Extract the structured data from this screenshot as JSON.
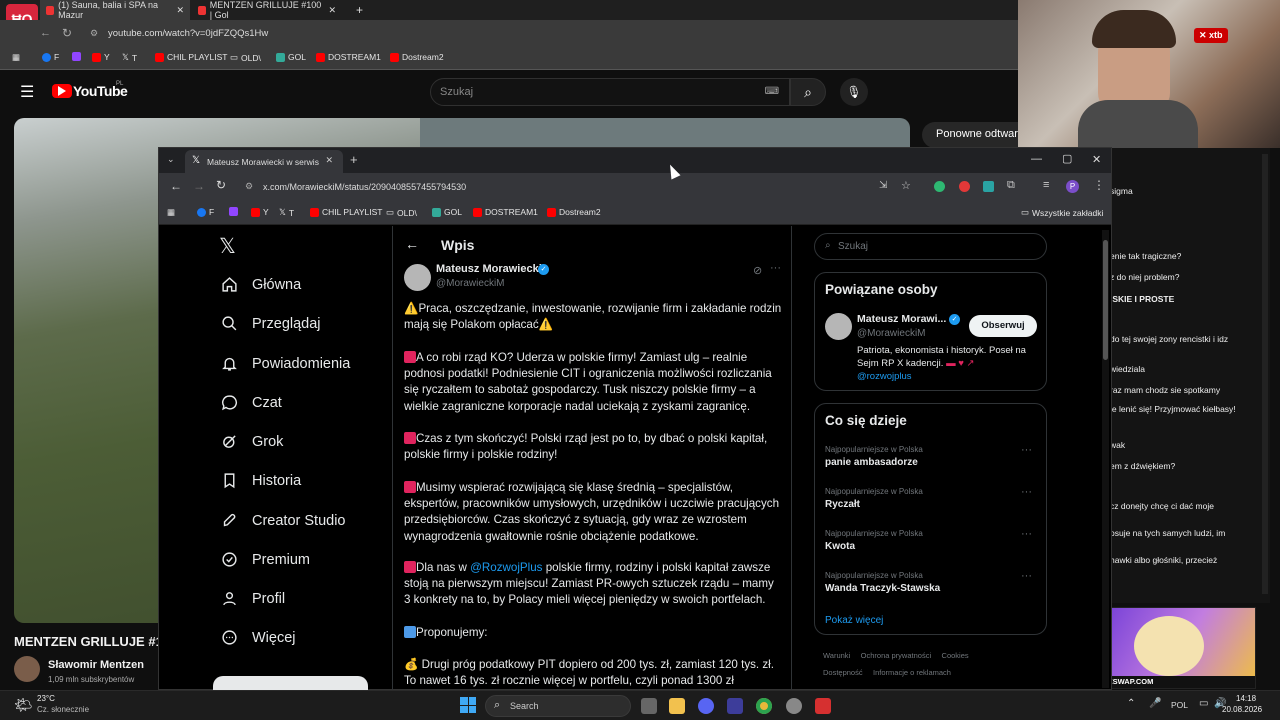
{
  "bg_browser": {
    "tabs": [
      {
        "label": "(1) Sauna, balia i SPA na Mazur"
      },
      {
        "label": "MENTZEN GRILLUJE #100 | Gol"
      }
    ],
    "url": "youtube.com/watch?v=0jdFZQQs1Hw",
    "bookmarks": [
      "F",
      "Y",
      "T",
      "CHIL PLAYLIST",
      "OLD\\",
      "GOL",
      "DOSTREAM1",
      "Dostream2"
    ],
    "youtube_logo": "YouTube",
    "youtube_country": "PL",
    "search_placeholder": "Szukaj",
    "rewatch_button": "Ponowne odtwar",
    "video_title": "MENTZEN GRILLUJE #1",
    "channel_name": "Sławomir Mentzen",
    "channel_subs": "1,09 mln subskrybentów"
  },
  "stream_overlay": {
    "logo": "ĦO",
    "cam_badge": "xtb",
    "banner_text": "PIRATESWAP.COM",
    "chat": [
      "sigma",
      "enie tak tragiczne?",
      "z do niej problem?",
      "ISKIE I PROSTE",
      "do tej swojej zony rencistki i idz",
      "wiedziala",
      "raz mam chodz sie spotkamy",
      "ie lenić się! Przyjmować kiełbasy!",
      "wak",
      "em z dźwiękiem?",
      "cz donejty chcę ci dać moje",
      "osuje na tych samych ludzi, im",
      "hawki albo głośniki, przecież"
    ]
  },
  "x_window": {
    "tab_title": "Mateusz Morawiecki w serwisie",
    "url": "x.com/MorawieckiM/status/2090408557455794530",
    "bookmarks": [
      "F",
      "Y",
      "T",
      "CHIL PLAYLIST",
      "OLD\\",
      "GOL",
      "DOSTREAM1",
      "Dostream2"
    ],
    "all_bookmarks": "Wszystkie zakładki",
    "nav": [
      "Główna",
      "Przeglądaj",
      "Powiadomienia",
      "Czat",
      "Grok",
      "Historia",
      "Creator Studio",
      "Premium",
      "Profil",
      "Więcej"
    ],
    "header": "Wpis",
    "author_name": "Mateusz Morawiecki",
    "author_handle": "@MorawieckiM",
    "post": {
      "p1": "Praca, oszczędzanie, inwestowanie, rozwijanie firm i zakładanie rodzin mają się Polakom opłacać",
      "p2": "A co robi rząd KO? Uderza w polskie firmy! Zamiast ulg – realnie podnosi podatki! Podniesienie CIT i ograniczenia możliwości rozliczania się ryczałtem to sabotaż gospodarczy. Tusk niszczy polskie firmy – a wielkie zagraniczne korporacje nadal uciekają z zyskami zagranicę.",
      "p3": "Czas z tym skończyć! Polski rząd jest po to, by dbać o polski kapitał, polskie firmy i polskie rodziny!",
      "p4": "Musimy wspierać rozwijającą się klasę średnią – specjalistów, ekspertów, pracowników umysłowych, urzędników i uczciwie pracujących przedsiębiorców. Czas skończyć z sytuacją, gdy wraz ze wzrostem wynagrodzenia gwałtownie rośnie obciążenie podatkowe.",
      "p5_prefix": "Dla nas w ",
      "p5_link": "@RozwojPlus",
      "p5_suffix": " polskie firmy, rodziny i polski kapitał zawsze stoją na pierwszym miejscu! Zamiast PR-owych sztuczek rządu – mamy 3 konkrety na to, by Polacy mieli więcej pieniędzy w swoich portfelach.",
      "p6": "Proponujemy:",
      "p7": "Drugi próg podatkowy PIT dopiero od 200 tys. zł, zamiast 120 tys. zł. To nawet 16 tys. zł rocznie więcej w portfelu, czyli ponad 1300 zł"
    },
    "search_placeholder": "Szukaj",
    "related": {
      "title": "Powiązane osoby",
      "name": "Mateusz Morawi...",
      "handle": "@MorawieckiM",
      "follow": "Obserwuj",
      "bio": "Patriota, ekonomista i historyk. Poseł na Sejm RP X kadencji.",
      "bio_link": "@rozwojplus"
    },
    "trends": {
      "title": "Co się dzieje",
      "items": [
        {
          "context": "Najpopularniejsze w Polska",
          "name": "panie ambasadorze"
        },
        {
          "context": "Najpopularniejsze w Polska",
          "name": "Ryczałt"
        },
        {
          "context": "Najpopularniejsze w Polska",
          "name": "Kwota"
        },
        {
          "context": "Najpopularniejsze w Polska",
          "name": "Wanda Traczyk-Stawska"
        }
      ],
      "more": "Pokaż więcej"
    },
    "footer": [
      "Warunki",
      "Ochrona prywatności",
      "Cookies",
      "Dostępność",
      "Informacje o reklamach"
    ]
  },
  "taskbar": {
    "weather_temp": "23°C",
    "weather_desc": "Cz. słonecznie",
    "search": "Search",
    "lang": "POL",
    "time": "14:18",
    "date": "20.08.2026"
  }
}
